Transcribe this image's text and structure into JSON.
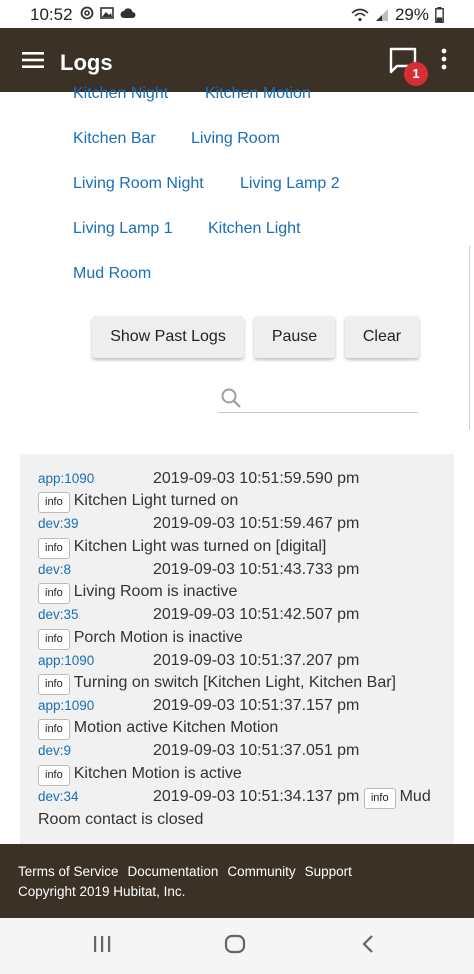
{
  "status_bar": {
    "time": "10:52",
    "battery": "29%",
    "icons": [
      "threads-icon",
      "image-icon",
      "cloud-icon",
      "wifi-icon",
      "signal-icon",
      "battery-icon"
    ]
  },
  "app_bar": {
    "title": "Logs",
    "notification_count": "1"
  },
  "device_links": [
    "Kitchen Night",
    "Kitchen Motion",
    "Kitchen Bar",
    "Living Room",
    "Living Room Night",
    "Living Lamp 2",
    "Living Lamp 1",
    "Kitchen Light",
    "Mud Room"
  ],
  "buttons": {
    "show_past_logs": "Show Past Logs",
    "pause": "Pause",
    "clear": "Clear"
  },
  "search": {
    "value": "",
    "placeholder": ""
  },
  "logs": [
    {
      "source": "app:1090",
      "timestamp": "2019-09-03 10:51:59.590 pm",
      "level": "info",
      "message": "Kitchen Light turned on"
    },
    {
      "source": "dev:39",
      "timestamp": "2019-09-03 10:51:59.467 pm",
      "level": "info",
      "message": "Kitchen Light was turned on [digital]"
    },
    {
      "source": "dev:8",
      "timestamp": "2019-09-03 10:51:43.733 pm",
      "level": "info",
      "message": "Living Room is inactive"
    },
    {
      "source": "dev:35",
      "timestamp": "2019-09-03 10:51:42.507 pm",
      "level": "info",
      "message": "Porch Motion is inactive"
    },
    {
      "source": "app:1090",
      "timestamp": "2019-09-03 10:51:37.207 pm",
      "level": "info",
      "message": "Turning on switch [Kitchen Light, Kitchen Bar]"
    },
    {
      "source": "app:1090",
      "timestamp": "2019-09-03 10:51:37.157 pm",
      "level": "info",
      "message": "Motion active Kitchen Motion"
    },
    {
      "source": "dev:9",
      "timestamp": "2019-09-03 10:51:37.051 pm",
      "level": "info",
      "message": "Kitchen Motion is active"
    },
    {
      "source": "dev:34",
      "timestamp": "2019-09-03 10:51:34.137 pm",
      "level": "info",
      "message": "Mud Room contact is closed"
    }
  ],
  "footer": {
    "links": [
      "Terms of Service",
      "Documentation",
      "Community",
      "Support"
    ],
    "copyright": "Copyright 2019 Hubitat, Inc."
  },
  "nav_bar": {
    "icons": [
      "recent-apps-icon",
      "home-icon",
      "back-icon"
    ]
  },
  "colors": {
    "header_bg": "#3c3127",
    "link": "#1a6fb5",
    "badge": "#d62e34",
    "log_bg": "#f1f1f1"
  }
}
